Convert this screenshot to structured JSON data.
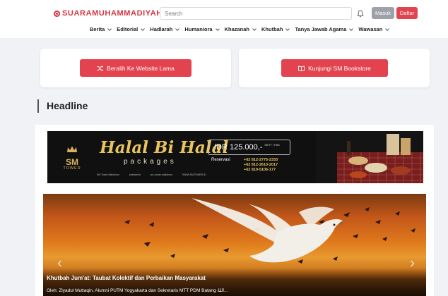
{
  "header": {
    "logo_text": "SUARAMUHAMMADIYAH",
    "search_placeholder": "Search",
    "login_label": "Masuk",
    "register_label": "Daftar"
  },
  "nav": {
    "items": [
      {
        "label": "Berita"
      },
      {
        "label": "Editorial"
      },
      {
        "label": "Hadlarah"
      },
      {
        "label": "Humaniora"
      },
      {
        "label": "Khazanah"
      },
      {
        "label": "Khutbah"
      },
      {
        "label": "Tanya Jawab Agama"
      },
      {
        "label": "Wawasan"
      }
    ]
  },
  "cards": {
    "old_site_label": "Beralih Ke Website Lama",
    "bookstore_label": "Kunjungi SM Bookstore"
  },
  "section": {
    "headline": "Headline"
  },
  "banner": {
    "logo_big": "SM",
    "logo_small": "TOWER",
    "title": "Halal Bi Halal",
    "subtitle": "packages",
    "price": "IDR 125.000,-",
    "price_note": "NETT / PAX",
    "reservation_label": "Reservasi",
    "phones": [
      "+62 812-2775-2333",
      "+62 812-2610-2017",
      "+62 819-5106-177"
    ],
    "footer_items": [
      "SM Tower Malioboro",
      "smtowerid",
      "sm_tower.malioboro",
      "WWW.SMTOWER.ID"
    ]
  },
  "slider": {
    "title": "Khutbah Jum'at: Taubat Kolektif dan Perbaikan Masyarakat",
    "author": "Oleh: Ziyadul Muttaqin, Alumni PUTM Yogyakarta dan Sekretaris MTT PDM Batang اللهُ..."
  },
  "colors": {
    "brand": "#d8343f",
    "accent_button": "#e2434f",
    "muted_button": "#9ea2a8",
    "banner_gold": "#e8c45f"
  }
}
